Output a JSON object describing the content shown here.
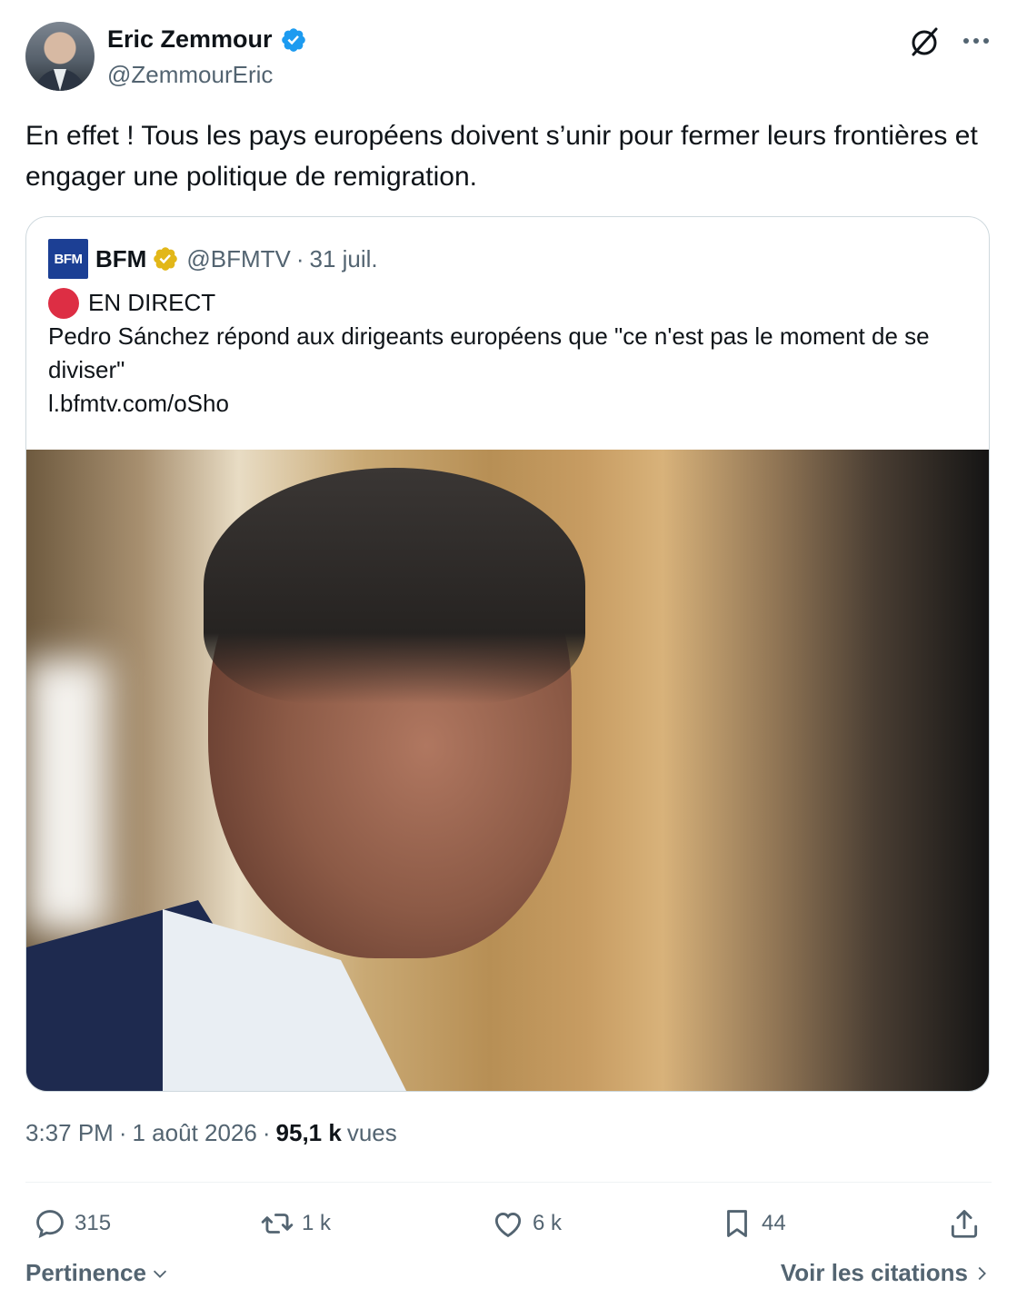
{
  "author": {
    "name": "Eric Zemmour",
    "handle": "@ZemmourEric",
    "verified_color": "#1d9bf0"
  },
  "tweet": {
    "text": "En effet ! Tous les pays européens doivent s’unir pour fermer leurs frontières et engager une politique de remigration."
  },
  "quoted": {
    "logo_text": "BFM",
    "name": "BFM",
    "handle": "@BFMTV",
    "separator": "·",
    "date": "31 juil.",
    "live_label": "EN DIRECT",
    "body": "Pedro Sánchez répond aux dirigeants européens que \"ce n'est pas le moment de se diviser\"",
    "link": "l.bfmtv.com/oSho",
    "badge_color": "#e2b719"
  },
  "meta": {
    "time": "3:37 PM",
    "sep1": "·",
    "date": "1 août 2026",
    "sep2": "·",
    "views_count": "95,1 k",
    "views_label": "vues"
  },
  "actions": {
    "replies": "315",
    "retweets": "1 k",
    "likes": "6 k",
    "bookmarks": "44"
  },
  "footer": {
    "sort_label": "Pertinence",
    "quotes_label": "Voir les citations"
  },
  "icons": [
    "verified-icon",
    "grok-icon",
    "more-icon",
    "gold-verified-icon",
    "reply-icon",
    "retweet-icon",
    "like-icon",
    "bookmark-icon",
    "share-icon",
    "chevron-down-icon",
    "chevron-right-icon"
  ]
}
